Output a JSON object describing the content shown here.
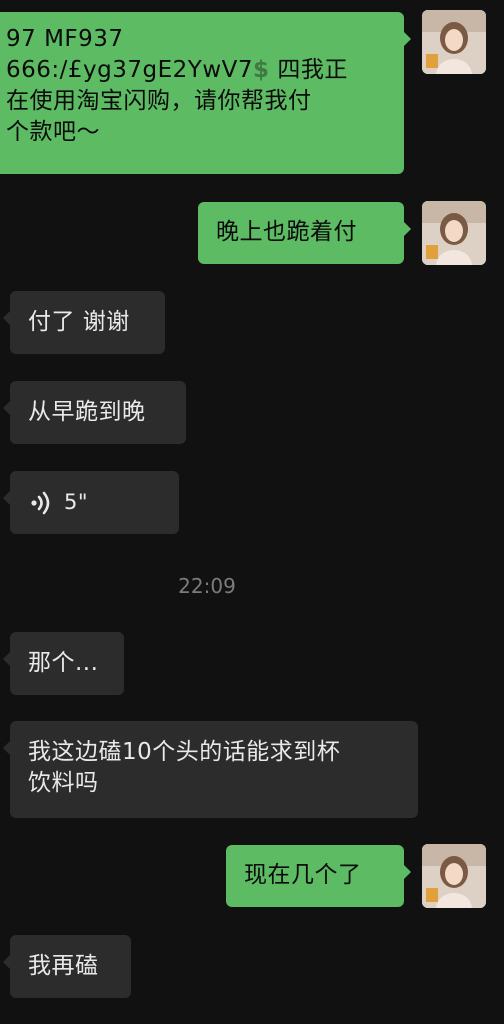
{
  "messages": [
    {
      "id": "m1",
      "side": "out",
      "lines": [
        "97 MF937",
        "666:/£yg37gE2YwV7",
        "在使用淘宝闪购，请你帮我付",
        "个款吧～"
      ],
      "inline_icon": "dollar-icon",
      "inline_icon_glyph": "$",
      "inline_after": " 四我正"
    },
    {
      "id": "m2",
      "side": "out",
      "text": "晚上也跪着付"
    },
    {
      "id": "m3",
      "side": "in",
      "text": "付了 谢谢"
    },
    {
      "id": "m4",
      "side": "in",
      "text": "从早跪到晚"
    },
    {
      "id": "m5",
      "side": "in",
      "type": "voice",
      "duration": "5\""
    },
    {
      "id": "m6",
      "side": "in",
      "text": "那个..."
    },
    {
      "id": "m7",
      "side": "in",
      "lines": [
        "我这边磕10个头的话能求到杯",
        "饮料吗"
      ]
    },
    {
      "id": "m8",
      "side": "out",
      "text": "现在几个了"
    },
    {
      "id": "m9",
      "side": "in",
      "text": "我再磕"
    }
  ],
  "timestamp": "22:09",
  "colors": {
    "background": "#111111",
    "outgoing_bubble": "#5dbb63",
    "incoming_bubble": "#2c2c2c",
    "timestamp_text": "#7c7c7c"
  }
}
